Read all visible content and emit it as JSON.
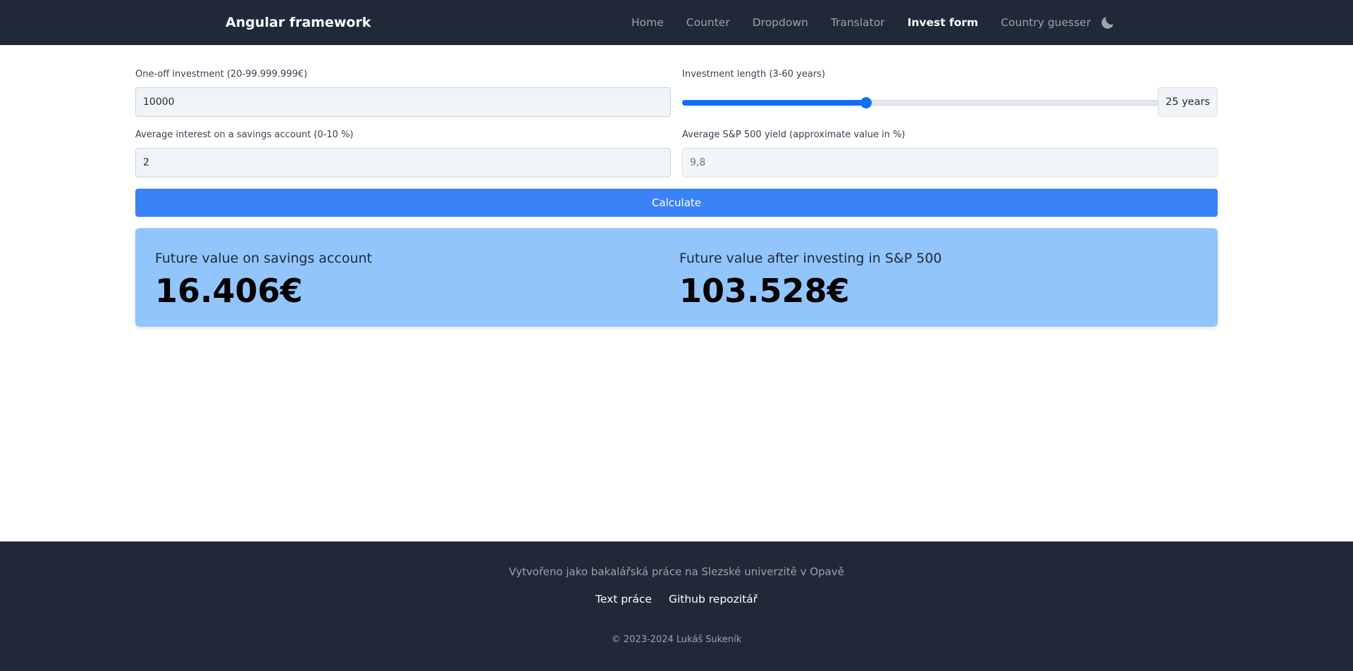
{
  "navbar": {
    "brand": "Angular framework",
    "links": [
      {
        "label": "Home",
        "active": false
      },
      {
        "label": "Counter",
        "active": false
      },
      {
        "label": "Dropdown",
        "active": false
      },
      {
        "label": "Translator",
        "active": false
      },
      {
        "label": "Invest form",
        "active": true
      },
      {
        "label": "Country guesser",
        "active": false
      }
    ],
    "theme_icon": "moon-icon"
  },
  "form": {
    "investment": {
      "label": "One-off investment (20-99.999.999€)",
      "value": "10000"
    },
    "length": {
      "label": "Investment length (3-60 years)",
      "value": 25,
      "min": 3,
      "max": 60,
      "display": "25 years"
    },
    "interest": {
      "label": "Average interest on a savings account (0-10 %)",
      "value": "2"
    },
    "yield": {
      "label": "Average S&P 500 yield (approximate value in %)",
      "placeholder": "9,8"
    },
    "calculate_label": "Calculate"
  },
  "results": {
    "savings": {
      "title": "Future value on savings account",
      "value": "16.406€"
    },
    "sp500": {
      "title": "Future value after investing in S&P 500",
      "value": "103.528€"
    }
  },
  "footer": {
    "text": "Vytvořeno jako bakalářská práce na Slezské univerzitě v Opavě",
    "links": [
      "Text práce",
      "Github repozitář"
    ],
    "copyright": "© 2023-2024 Lukáš Sukeník"
  },
  "colors": {
    "navbar_bg": "#1f2937",
    "accent": "#3b82f6",
    "result_bg": "#93c5fd"
  }
}
